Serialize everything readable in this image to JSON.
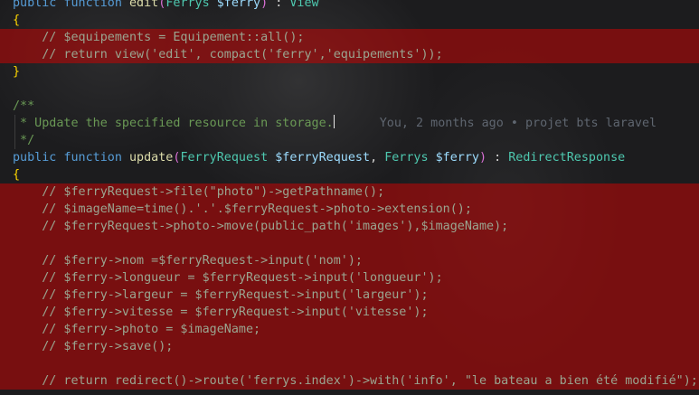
{
  "editor": {
    "lines": [
      {
        "segments": [
          {
            "t": "public",
            "c": "kw"
          },
          {
            "t": " ",
            "c": "pl"
          },
          {
            "t": "function",
            "c": "kw"
          },
          {
            "t": " ",
            "c": "pl"
          },
          {
            "t": "edit",
            "c": "fn"
          },
          {
            "t": "(",
            "c": "br2"
          },
          {
            "t": "Ferrys",
            "c": "ty"
          },
          {
            "t": " ",
            "c": "pl"
          },
          {
            "t": "$ferry",
            "c": "vr"
          },
          {
            "t": ")",
            "c": "br2"
          },
          {
            "t": " : ",
            "c": "pl"
          },
          {
            "t": "View",
            "c": "ty"
          }
        ],
        "highlight": false
      },
      {
        "segments": [
          {
            "t": "{",
            "c": "br"
          }
        ],
        "highlight": false
      },
      {
        "segments": [
          {
            "t": "    // $equipements = Equipement::all();",
            "c": "cmd"
          }
        ],
        "highlight": true
      },
      {
        "segments": [
          {
            "t": "    // return view('edit', compact('ferry','equipements'));",
            "c": "cmd"
          }
        ],
        "highlight": true
      },
      {
        "segments": [
          {
            "t": "}",
            "c": "br"
          }
        ],
        "highlight": false
      },
      {
        "segments": [
          {
            "t": "",
            "c": "pl"
          }
        ],
        "highlight": false
      },
      {
        "segments": [
          {
            "t": "/**",
            "c": "doc"
          }
        ],
        "highlight": false
      },
      {
        "segments": [
          {
            "t": " * Update the specified resource in storage.",
            "c": "doc"
          }
        ],
        "highlight": false,
        "caret": true,
        "blame": "You, 2 months ago • projet bts laravel"
      },
      {
        "segments": [
          {
            "t": " */",
            "c": "doc"
          }
        ],
        "highlight": false
      },
      {
        "segments": [
          {
            "t": "public",
            "c": "kw"
          },
          {
            "t": " ",
            "c": "pl"
          },
          {
            "t": "function",
            "c": "kw"
          },
          {
            "t": " ",
            "c": "pl"
          },
          {
            "t": "update",
            "c": "fn"
          },
          {
            "t": "(",
            "c": "br2"
          },
          {
            "t": "FerryRequest",
            "c": "ty"
          },
          {
            "t": " ",
            "c": "pl"
          },
          {
            "t": "$ferryRequest",
            "c": "vr"
          },
          {
            "t": ", ",
            "c": "pl"
          },
          {
            "t": "Ferrys",
            "c": "ty"
          },
          {
            "t": " ",
            "c": "pl"
          },
          {
            "t": "$ferry",
            "c": "vr"
          },
          {
            "t": ")",
            "c": "br2"
          },
          {
            "t": " : ",
            "c": "pl"
          },
          {
            "t": "RedirectResponse",
            "c": "ty"
          }
        ],
        "highlight": false
      },
      {
        "segments": [
          {
            "t": "{",
            "c": "br"
          }
        ],
        "highlight": false
      },
      {
        "segments": [
          {
            "t": "    // $ferryRequest->file(\"photo\")->getPathname();",
            "c": "cmd"
          }
        ],
        "highlight": true
      },
      {
        "segments": [
          {
            "t": "    // $imageName=time().'.'.$ferryRequest->photo->extension();",
            "c": "cmd"
          }
        ],
        "highlight": true
      },
      {
        "segments": [
          {
            "t": "    // $ferryRequest->photo->move(public_path('images'),$imageName);",
            "c": "cmd"
          }
        ],
        "highlight": true
      },
      {
        "segments": [
          {
            "t": "",
            "c": "pl"
          }
        ],
        "highlight": true
      },
      {
        "segments": [
          {
            "t": "    // $ferry->nom =$ferryRequest->input('nom');",
            "c": "cmd"
          }
        ],
        "highlight": true
      },
      {
        "segments": [
          {
            "t": "    // $ferry->longueur = $ferryRequest->input('longueur');",
            "c": "cmd"
          }
        ],
        "highlight": true
      },
      {
        "segments": [
          {
            "t": "    // $ferry->largeur = $ferryRequest->input('largeur');",
            "c": "cmd"
          }
        ],
        "highlight": true
      },
      {
        "segments": [
          {
            "t": "    // $ferry->vitesse = $ferryRequest->input('vitesse');",
            "c": "cmd"
          }
        ],
        "highlight": true
      },
      {
        "segments": [
          {
            "t": "    // $ferry->photo = $imageName;",
            "c": "cmd"
          }
        ],
        "highlight": true
      },
      {
        "segments": [
          {
            "t": "    // $ferry->save();",
            "c": "cmd"
          }
        ],
        "highlight": true
      },
      {
        "segments": [
          {
            "t": "",
            "c": "pl"
          }
        ],
        "highlight": true
      },
      {
        "segments": [
          {
            "t": "    // return redirect()->route('ferrys.index')->with('info', \"le bateau a bien été modifié\");",
            "c": "cmd"
          }
        ],
        "highlight": true
      }
    ]
  }
}
